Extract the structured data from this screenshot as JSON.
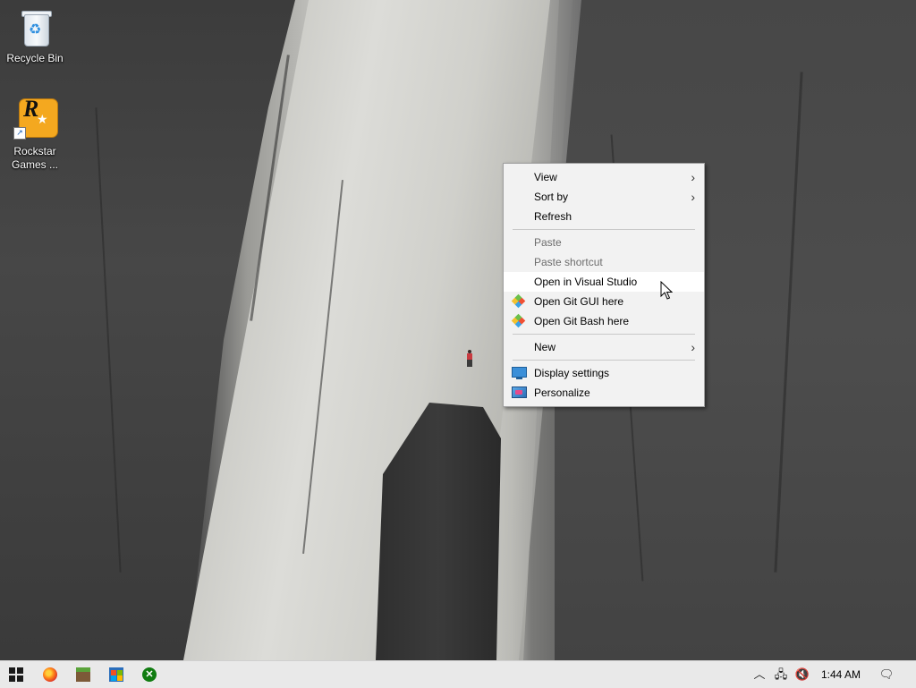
{
  "desktop": {
    "icons": [
      {
        "label": "Recycle Bin"
      },
      {
        "label": "Rockstar Games ..."
      }
    ]
  },
  "context_menu": {
    "items": [
      {
        "label": "View",
        "submenu": true
      },
      {
        "label": "Sort by",
        "submenu": true
      },
      {
        "label": "Refresh"
      },
      {
        "label": "Paste",
        "disabled": true
      },
      {
        "label": "Paste shortcut",
        "disabled": true
      },
      {
        "label": "Open in Visual Studio",
        "hovered": true
      },
      {
        "label": "Open Git GUI here",
        "icon": "git-icon"
      },
      {
        "label": "Open Git Bash here",
        "icon": "git-icon"
      },
      {
        "label": "New",
        "submenu": true
      },
      {
        "label": "Display settings",
        "icon": "display-icon"
      },
      {
        "label": "Personalize",
        "icon": "personalize-icon"
      }
    ]
  },
  "taskbar": {
    "pinned": [
      "start-icon",
      "firefox-icon",
      "minecraft-icon",
      "store-icon",
      "xbox-icon"
    ],
    "tray": {
      "clock": "1:44 AM"
    }
  }
}
